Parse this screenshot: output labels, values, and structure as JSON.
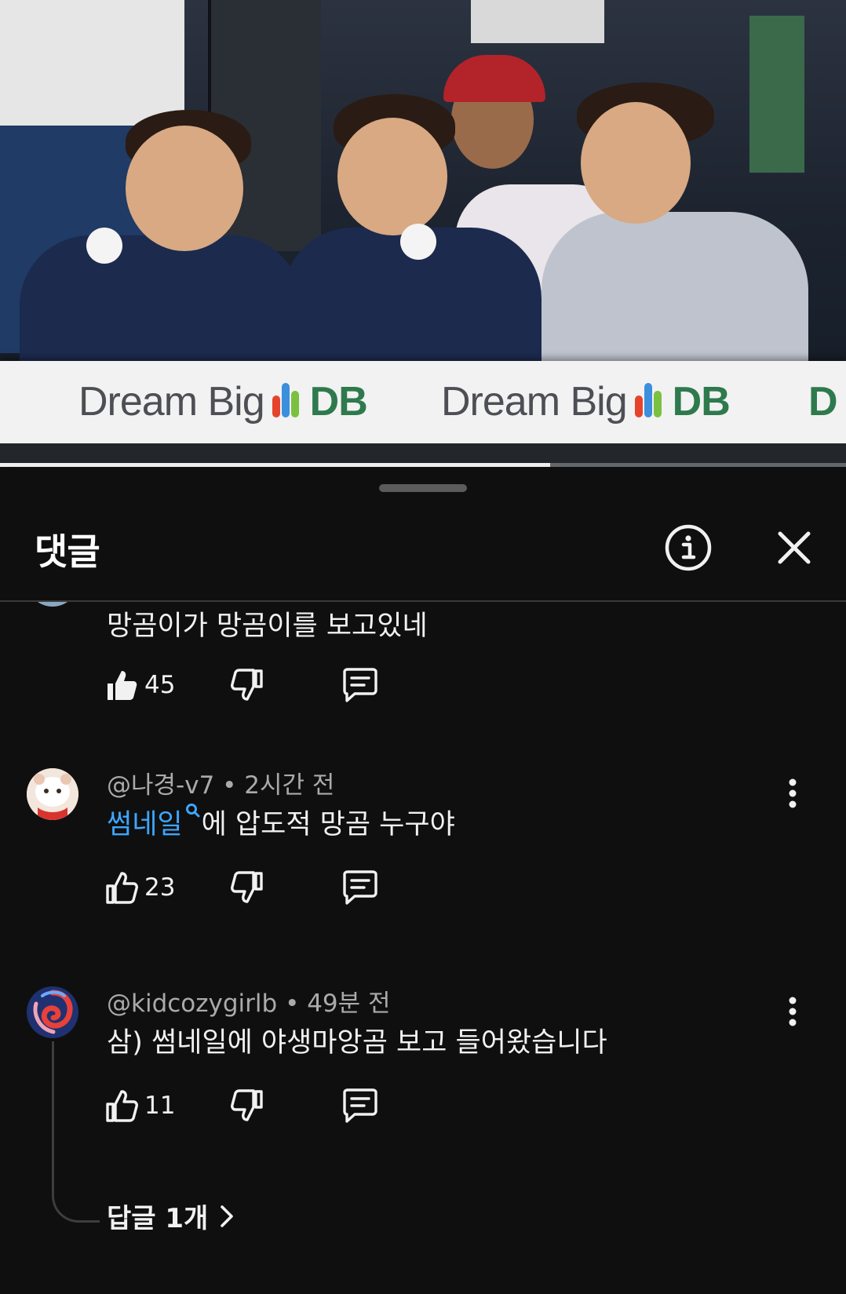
{
  "video": {
    "banner_text": "Dream Big",
    "banner_brand": "DB",
    "progress_fraction": 0.65
  },
  "panel": {
    "title": "댓글",
    "icons": {
      "info": "info-circle-icon",
      "close": "close-icon"
    }
  },
  "comments": [
    {
      "text": "망곰이가 망곰이를 보고있네",
      "likes": "45",
      "liked": true
    },
    {
      "author": "@나경-v7",
      "time": "2시간 전",
      "link_text": "썸네일",
      "text": "에 압도적 망곰 누구야",
      "likes": "23",
      "liked": false
    },
    {
      "author": "@kidcozygirlb",
      "time": "49분 전",
      "text": "삼) 썸네일에 야생마앙곰 보고 들어왔습니다",
      "likes": "11",
      "liked": false,
      "replies_label": "답글 1개"
    }
  ],
  "colors": {
    "background": "#0f0f0f",
    "link": "#3ea6ff",
    "meta": "#aaaaaa"
  }
}
